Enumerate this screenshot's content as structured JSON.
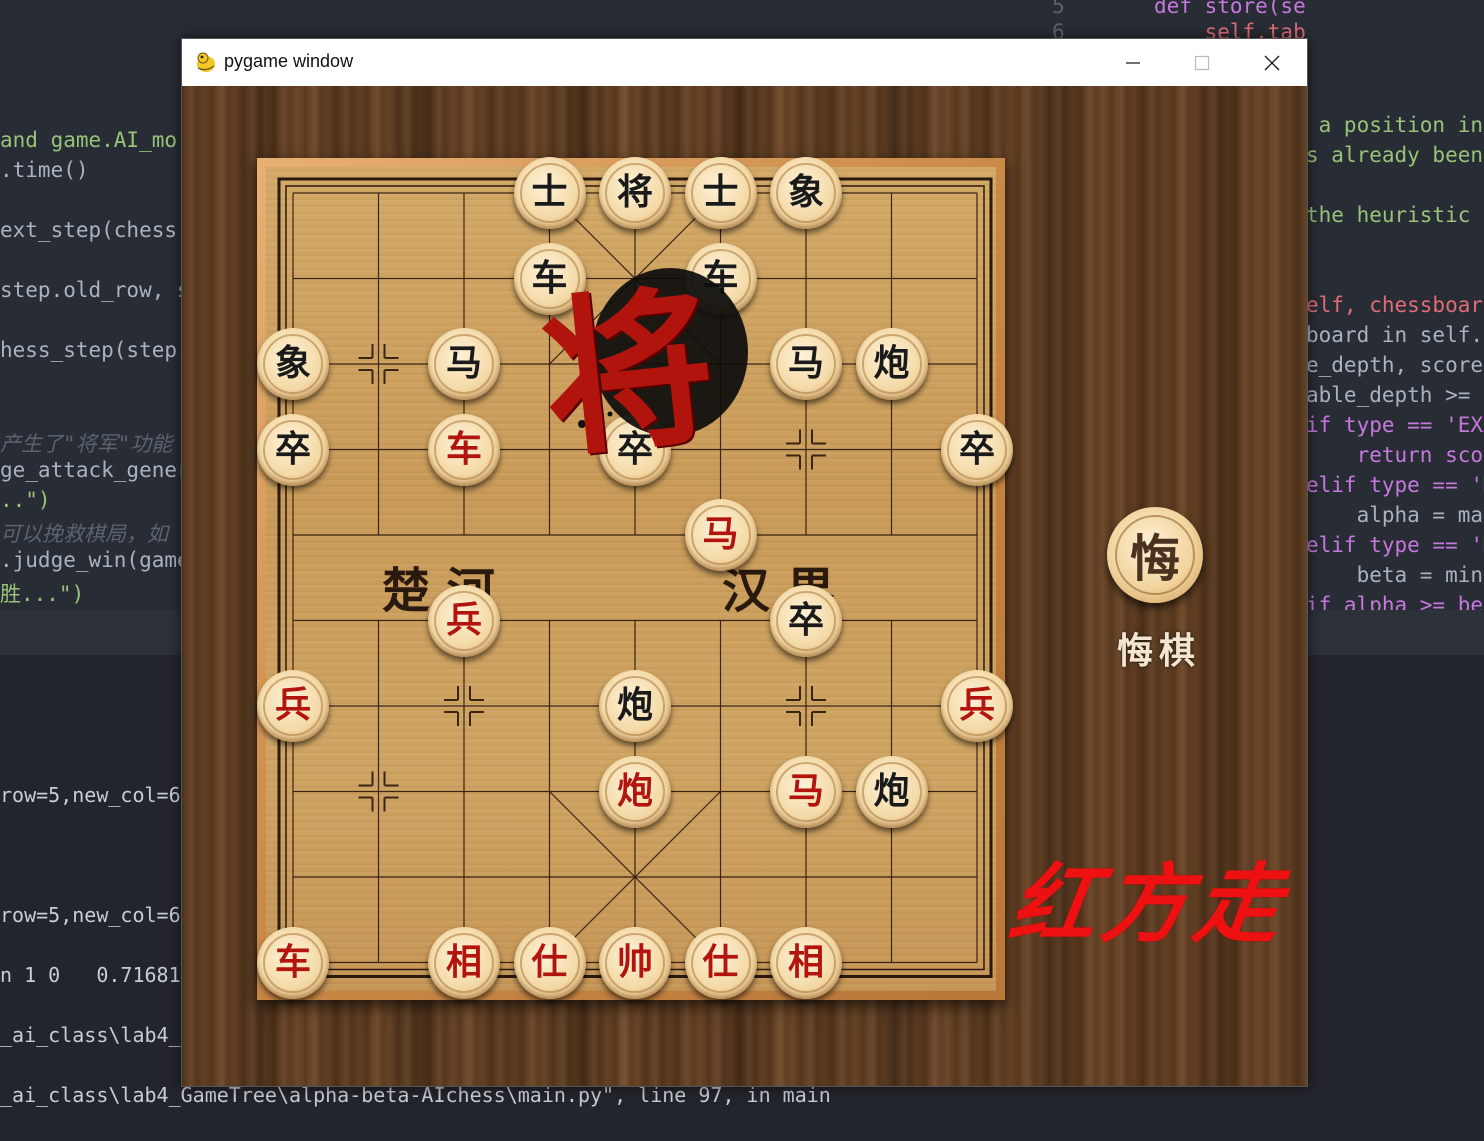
{
  "editor": {
    "top_lines": [
      {
        "num": "5",
        "code": "def store(self, chessboard, "
      },
      {
        "num": "6",
        "code": "    self.table[chessboard] "
      }
    ],
    "left_lines": [
      "and game.AI_mo",
      ".time()",
      "ext_step(chess",
      "step.old_row, s",
      "hess_step(step)",
      "产生了\"将军\"功能",
      "ge_attack_gener",
      "..\")",
      "可以挽救棋局，如",
      ".judge_win(game",
      "胜...\")"
    ],
    "right_lines": [
      " a position in",
      "s already been",
      "the heuristic s",
      "elf, chessboard",
      "board in self.t",
      "e_depth, score,",
      "able_depth >= d",
      "if type == 'EXA",
      "    return scor",
      "elif type == 'M",
      "    alpha = max",
      "elif type == 'M",
      "    beta = min(",
      "if alpha >= bet"
    ]
  },
  "terminal": {
    "lines": [
      "row=5,new_col=6",
      "row=5,new_col=6",
      "n 1 0   0.71681",
      "_ai_class\\lab4_",
      "_ai_class\\lab4_GameTree\\alpha-beta-AIchess\\main.py\", line 97, in main"
    ]
  },
  "window": {
    "title": "pygame window",
    "minimize_label": "—",
    "maximize_label": "☐",
    "close_label": "✕"
  },
  "game": {
    "check_seal_char": "将",
    "river_left": "楚 河",
    "river_right": "汉 界",
    "undo_char": "悔",
    "undo_label": "悔棋",
    "turn_text": "红方走",
    "pieces": [
      {
        "char": "士",
        "side": "black",
        "col": 3,
        "row": 0
      },
      {
        "char": "将",
        "side": "black",
        "col": 4,
        "row": 0
      },
      {
        "char": "士",
        "side": "black",
        "col": 5,
        "row": 0
      },
      {
        "char": "象",
        "side": "black",
        "col": 6,
        "row": 0
      },
      {
        "char": "车",
        "side": "black",
        "col": 3,
        "row": 1
      },
      {
        "char": "车",
        "side": "black",
        "col": 5,
        "row": 1
      },
      {
        "char": "象",
        "side": "black",
        "col": 0,
        "row": 2
      },
      {
        "char": "马",
        "side": "black",
        "col": 2,
        "row": 2
      },
      {
        "char": "马",
        "side": "black",
        "col": 6,
        "row": 2
      },
      {
        "char": "炮",
        "side": "black",
        "col": 7,
        "row": 2
      },
      {
        "char": "卒",
        "side": "black",
        "col": 0,
        "row": 3
      },
      {
        "char": "车",
        "side": "red",
        "col": 2,
        "row": 3
      },
      {
        "char": "卒",
        "side": "black",
        "col": 4,
        "row": 3
      },
      {
        "char": "卒",
        "side": "black",
        "col": 8,
        "row": 3
      },
      {
        "char": "马",
        "side": "red",
        "col": 5,
        "row": 4
      },
      {
        "char": "兵",
        "side": "red",
        "col": 2,
        "row": 5
      },
      {
        "char": "卒",
        "side": "black",
        "col": 6,
        "row": 5
      },
      {
        "char": "兵",
        "side": "red",
        "col": 0,
        "row": 6
      },
      {
        "char": "炮",
        "side": "black",
        "col": 4,
        "row": 6
      },
      {
        "char": "兵",
        "side": "red",
        "col": 8,
        "row": 6
      },
      {
        "char": "炮",
        "side": "red",
        "col": 4,
        "row": 7
      },
      {
        "char": "马",
        "side": "red",
        "col": 6,
        "row": 7
      },
      {
        "char": "炮",
        "side": "black",
        "col": 7,
        "row": 7
      },
      {
        "char": "车",
        "side": "red",
        "col": 0,
        "row": 9
      },
      {
        "char": "相",
        "side": "red",
        "col": 2,
        "row": 9
      },
      {
        "char": "仕",
        "side": "red",
        "col": 3,
        "row": 9
      },
      {
        "char": "帅",
        "side": "red",
        "col": 4,
        "row": 9
      },
      {
        "char": "仕",
        "side": "red",
        "col": 5,
        "row": 9
      },
      {
        "char": "相",
        "side": "red",
        "col": 6,
        "row": 9
      }
    ]
  }
}
